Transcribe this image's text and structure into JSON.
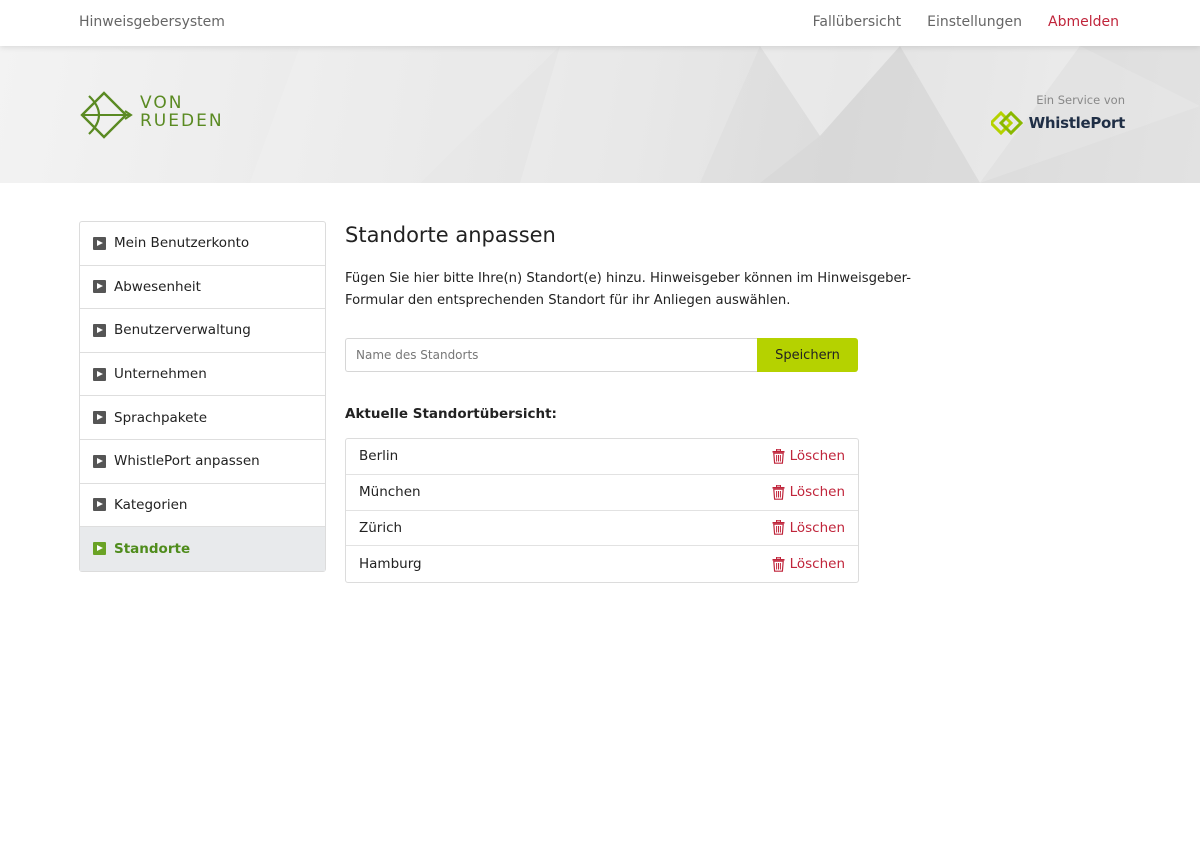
{
  "topbar": {
    "brand": "Hinweisgebersystem",
    "nav": {
      "overview": "Fallübersicht",
      "settings": "Einstellungen",
      "logout": "Abmelden"
    }
  },
  "banner": {
    "logo_line1": "VON",
    "logo_line2": "RUEDEN",
    "service_label": "Ein Service von",
    "service_brand": "WhistlePort"
  },
  "sidebar": {
    "items": [
      {
        "label": "Mein Benutzerkonto"
      },
      {
        "label": "Abwesenheit"
      },
      {
        "label": "Benutzerverwaltung"
      },
      {
        "label": "Unternehmen"
      },
      {
        "label": "Sprachpakete"
      },
      {
        "label": "WhistlePort anpassen"
      },
      {
        "label": "Kategorien"
      },
      {
        "label": "Standorte"
      }
    ],
    "active": "Standorte"
  },
  "main": {
    "title": "Standorte anpassen",
    "description": "Fügen Sie hier bitte Ihre(n) Standort(e) hinzu. Hinweisgeber können im Hinweisgeber-Formular den entsprechenden Standort für ihr Anliegen auswählen.",
    "input_placeholder": "Name des Standorts",
    "input_value": "",
    "save_label": "Speichern",
    "overview_title": "Aktuelle Standortübersicht:",
    "locations": [
      {
        "name": "Berlin",
        "delete_label": "Löschen"
      },
      {
        "name": "München",
        "delete_label": "Löschen"
      },
      {
        "name": "Zürich",
        "delete_label": "Löschen"
      },
      {
        "name": "Hamburg",
        "delete_label": "Löschen"
      }
    ]
  },
  "colors": {
    "accent_green": "#b5d200",
    "logo_green": "#5a8a22",
    "danger_red": "#c0253b",
    "brand_navy": "#1f2e45"
  },
  "icons": {
    "sidebar_item": "play-square-icon",
    "delete": "trash-icon"
  }
}
